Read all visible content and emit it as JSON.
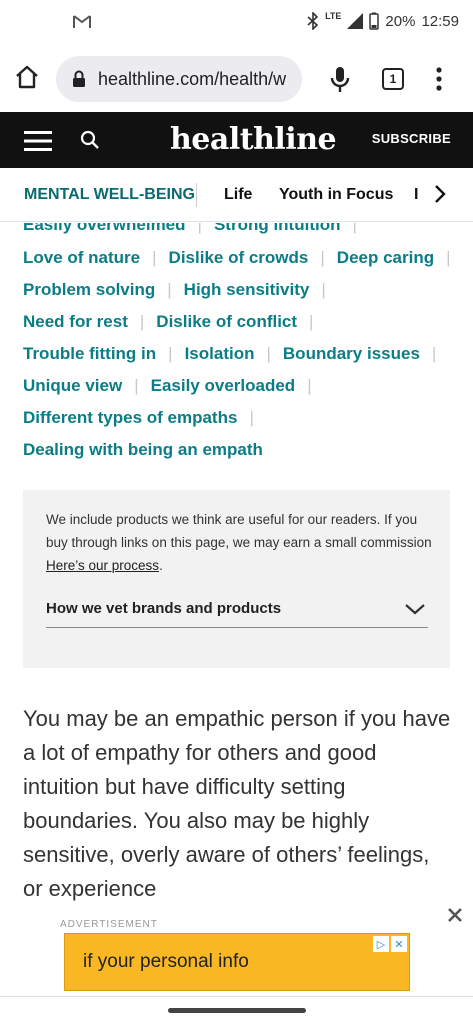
{
  "status_bar": {
    "network": "LTE",
    "battery": "20%",
    "time": "12:59",
    "icons": [
      "gmail-icon",
      "bluetooth-icon",
      "signal-icon",
      "battery-icon"
    ]
  },
  "browser": {
    "url": "healthline.com/health/w",
    "tab_count": "1"
  },
  "header": {
    "logo": "healthline",
    "subscribe": "SUBSCRIBE"
  },
  "nav": {
    "active": "MENTAL WELL-BEING",
    "items": [
      "Life",
      "Youth in Focus",
      "I"
    ]
  },
  "toc": {
    "partial_line": [
      "Easily overwhelmed",
      "Strong intuition"
    ],
    "rows": [
      [
        "Love of nature",
        "Dislike of crowds",
        "Deep caring"
      ],
      [
        "Problem solving",
        "High sensitivity"
      ],
      [
        "Need for rest",
        "Dislike of conflict"
      ],
      [
        "Trouble fitting in",
        "Isolation",
        "Boundary issues"
      ],
      [
        "Unique view",
        "Easily overloaded"
      ],
      [
        "Different types of empaths"
      ],
      [
        "Dealing with being an empath"
      ]
    ]
  },
  "disclosure": {
    "text": "We include products we think are useful for our readers. If you buy through links on this page, we may earn a small commission",
    "link": "Here’s our process",
    "end": ".",
    "vet_label": "How we vet brands and products"
  },
  "article": {
    "paragraph": "You may be an empathic person if you have a lot of empathy for others and good intuition but have difficulty setting boundaries. You also may be highly sensitive, overly aware of others’ feelings, or experience"
  },
  "ad": {
    "label": "ADVERTISEMENT",
    "text": "if your personal info"
  },
  "colors": {
    "accent": "#0a7e84",
    "header_bg": "#111111",
    "ad_bg": "#f9b724"
  }
}
